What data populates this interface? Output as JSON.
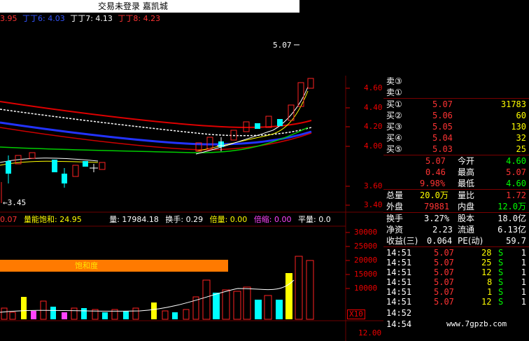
{
  "window": {
    "title": "交易未登录  嘉凯城"
  },
  "legend": [
    {
      "text": "3.95",
      "color": "#ff3333"
    },
    {
      "text": "丁丁6: 4.03",
      "color": "#3355ff"
    },
    {
      "text": "丁丁7: 4.13",
      "color": "#ffffff"
    },
    {
      "text": "丁丁8: 4.23",
      "color": "#ff3333"
    }
  ],
  "price_marks": {
    "high_label": "5.07",
    "low_label": "←3.45"
  },
  "price_axis": [
    "4.60",
    "4.40",
    "4.20",
    "4.00",
    "3.60",
    "3.40"
  ],
  "volume_axis": [
    "30000",
    "25000",
    "20000",
    "15000",
    "10000"
  ],
  "volume_scale_label": "X10",
  "bottom_axis_label": "12.00",
  "indicator_bar": [
    {
      "text": "0.07",
      "color": "#ff3333"
    },
    {
      "text": "量能饱和: 24.95",
      "color": "#ffff00"
    },
    {
      "text": "量: 17984.18",
      "color": "#ffffff"
    },
    {
      "text": "换手: 0.29",
      "color": "#ffffff"
    },
    {
      "text": "倍量: 0.00",
      "color": "#ffff00"
    },
    {
      "text": "倍缩: 0.00",
      "color": "#ff44ff"
    },
    {
      "text": "平量: 0.0",
      "color": "#ffffff"
    }
  ],
  "saturation_label": "饱和度",
  "order_book": {
    "sell_partial": [
      "卖③",
      "卖②",
      "卖①"
    ],
    "buys": [
      {
        "label": "买①",
        "price": "5.07",
        "vol": "31783"
      },
      {
        "label": "买②",
        "price": "5.06",
        "vol": "60"
      },
      {
        "label": "买③",
        "price": "5.05",
        "vol": "130"
      },
      {
        "label": "买④",
        "price": "5.04",
        "vol": "32"
      },
      {
        "label": "买⑤",
        "price": "5.03",
        "vol": "25"
      }
    ]
  },
  "quote": [
    {
      "v1": "5.07",
      "k": "今开",
      "v2": "4.60",
      "c1": "#ff3333",
      "c2": "#00ff00"
    },
    {
      "v1": "0.46",
      "k": "最高",
      "v2": "5.07",
      "c1": "#ff3333",
      "c2": "#ff3333"
    },
    {
      "v1": "9.98%",
      "k": "最低",
      "v2": "4.60",
      "c1": "#ff3333",
      "c2": "#00ff00"
    }
  ],
  "stats": [
    {
      "k1": "总量",
      "v1": "20.0万",
      "k2": "量比",
      "v2": "1.72",
      "c1": "#ffff00",
      "c2": "#ff3333"
    },
    {
      "k1": "外盘",
      "v1": "79881",
      "k2": "内盘",
      "v2": "12.0万",
      "c1": "#ff3333",
      "c2": "#00ff00"
    },
    {
      "k1": "换手",
      "v1": "3.27%",
      "k2": "股本",
      "v2": "18.0亿",
      "c1": "#ffffff",
      "c2": "#ffffff"
    },
    {
      "k1": "净资",
      "v1": "2.23",
      "k2": "流通",
      "v2": "6.13亿",
      "c1": "#ffffff",
      "c2": "#ffffff"
    },
    {
      "k1": "收益(三)",
      "v1": "0.064",
      "k2": "PE(动)",
      "v2": "59.7",
      "c1": "#ffffff",
      "c2": "#ffffff"
    }
  ],
  "ticks": [
    {
      "time": "14:51",
      "price": "5.07",
      "vol": "28",
      "side": "S",
      "extra": "1"
    },
    {
      "time": "14:51",
      "price": "5.07",
      "vol": "25",
      "side": "S",
      "extra": "1"
    },
    {
      "time": "14:51",
      "price": "5.07",
      "vol": "12",
      "side": "S",
      "extra": "1"
    },
    {
      "time": "14:51",
      "price": "5.07",
      "vol": "8",
      "side": "S",
      "extra": "1"
    },
    {
      "time": "14:51",
      "price": "5.07",
      "vol": "1",
      "side": "S",
      "extra": "1"
    },
    {
      "time": "14:51",
      "price": "5.07",
      "vol": "12",
      "side": "S",
      "extra": "1"
    },
    {
      "time": "14:52",
      "price": "",
      "vol": "",
      "side": "",
      "extra": ""
    },
    {
      "time": "14:54",
      "price": "",
      "vol": "",
      "side": "",
      "extra": ""
    }
  ],
  "watermark": "www.7gpzb.com"
}
